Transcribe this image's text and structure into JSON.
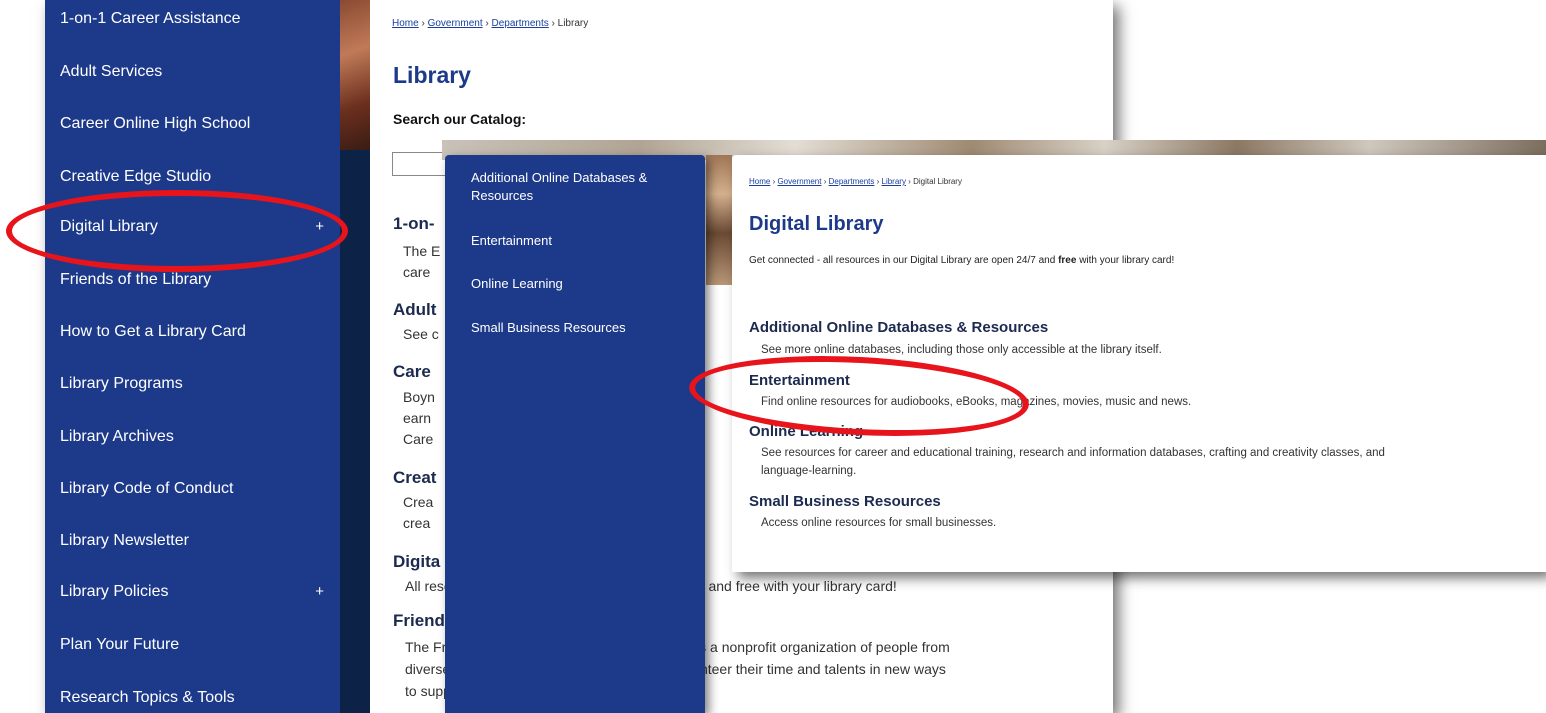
{
  "back_page": {
    "nav_items": [
      {
        "label": "1-on-1 Career Assistance",
        "plus": ""
      },
      {
        "label": "Adult Services",
        "plus": ""
      },
      {
        "label": "Career Online High School",
        "plus": ""
      },
      {
        "label": "Creative Edge Studio",
        "plus": ""
      },
      {
        "label": "Digital Library",
        "plus": "+"
      },
      {
        "label": "Friends of the Library",
        "plus": ""
      },
      {
        "label": "How to Get a Library Card",
        "plus": ""
      },
      {
        "label": "Library Programs",
        "plus": ""
      },
      {
        "label": "Library Archives",
        "plus": ""
      },
      {
        "label": "Library Code of Conduct",
        "plus": ""
      },
      {
        "label": "Library Newsletter",
        "plus": ""
      },
      {
        "label": "Library Policies",
        "plus": "+"
      },
      {
        "label": "Plan Your Future",
        "plus": ""
      },
      {
        "label": "Research Topics & Tools",
        "plus": ""
      }
    ],
    "breadcrumb": {
      "home": "Home",
      "sep": " › ",
      "government": "Government",
      "departments": "Departments",
      "current": "Library"
    },
    "title": "Library",
    "search_label": "Search our Catalog:",
    "sections": {
      "s1_heading": "1-on-",
      "s1_frag1": "The E",
      "s1_frag2": "care",
      "adult_heading": "Adult",
      "adult_frag": "See c",
      "career_heading": "Care",
      "career_frag1": "Boyn",
      "career_frag2": "earn",
      "career_frag3": "Care",
      "creative_heading": "Creat",
      "creative_frag1": "Crea",
      "creative_frag2": "crea",
      "digital_heading": "Digita",
      "digital_text": "All resources in our Digital Library are open 24/7 and free with your library card!",
      "friends_heading": "Friends of the Library",
      "friends_text_1": "The Friends of the Boynton Beach City Library is a nonprofit organization of people from",
      "friends_text_2": "diverse backgrounds and experiences who volunteer their time and talents in new ways",
      "friends_text_3": "to support the Library."
    }
  },
  "front_page": {
    "nav_items": [
      {
        "label": "Additional Online Databases & Resources"
      },
      {
        "label": "Entertainment"
      },
      {
        "label": "Online Learning"
      },
      {
        "label": "Small Business Resources"
      }
    ],
    "breadcrumb": {
      "home": "Home",
      "sep": " › ",
      "government": "Government",
      "departments": "Departments",
      "library": "Library",
      "current": "Digital Library"
    },
    "title": "Digital Library",
    "intro_pre": "Get connected - all resources in our Digital Library are open 24/7 and ",
    "intro_bold": "free",
    "intro_post": " with your library card!",
    "sections": [
      {
        "heading": "Additional Online Databases & Resources",
        "text": "See more online databases, including those only accessible at the library itself."
      },
      {
        "heading": "Entertainment",
        "text": "Find online resources for audiobooks, eBooks, magazines, movies, music and news."
      },
      {
        "heading": "Online Learning",
        "text": "See resources for career and educational training, research and information databases, crafting and creativity classes, and",
        "text2": "language-learning."
      },
      {
        "heading": "Small Business Resources",
        "text": "Access online resources for small businesses."
      }
    ]
  },
  "annotation_color": "#e8141b",
  "accent_color": "#1d3a8a"
}
